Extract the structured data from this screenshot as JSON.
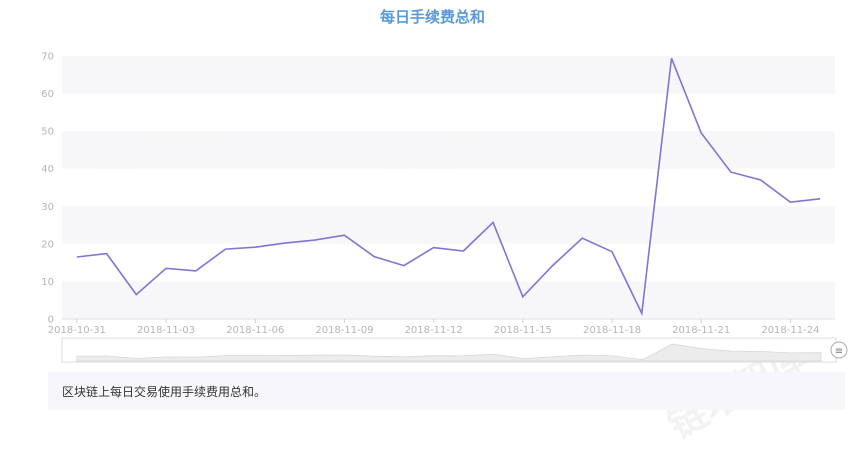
{
  "title": "每日手续费总和",
  "description": "区块链上每日交易使用手续费用总和。",
  "watermark": "链塔智库",
  "colors": {
    "line": "#8174d6",
    "title": "#5a9ad6",
    "band": "#f7f7f9",
    "axis_text": "#b5b5b5"
  },
  "chart_data": {
    "type": "line",
    "title": "每日手续费总和",
    "xlabel": "",
    "ylabel": "",
    "ylim": [
      0,
      70
    ],
    "y_ticks": [
      0,
      10,
      20,
      30,
      40,
      50,
      60,
      70
    ],
    "x_tick_labels": [
      "2018-10-31",
      "2018-11-03",
      "2018-11-06",
      "2018-11-09",
      "2018-11-12",
      "2018-11-15",
      "2018-11-18",
      "2018-11-21",
      "2018-11-24"
    ],
    "x": [
      "2018-10-31",
      "2018-11-01",
      "2018-11-02",
      "2018-11-03",
      "2018-11-04",
      "2018-11-05",
      "2018-11-06",
      "2018-11-07",
      "2018-11-08",
      "2018-11-09",
      "2018-11-10",
      "2018-11-11",
      "2018-11-12",
      "2018-11-13",
      "2018-11-14",
      "2018-11-15",
      "2018-11-16",
      "2018-11-17",
      "2018-11-18",
      "2018-11-19",
      "2018-11-20",
      "2018-11-21",
      "2018-11-22",
      "2018-11-23",
      "2018-11-24",
      "2018-11-25"
    ],
    "series": [
      {
        "values": [
          16.5,
          17.4,
          6.5,
          13.5,
          12.8,
          18.6,
          19.1,
          20.2,
          21.0,
          22.3,
          16.6,
          14.2,
          19.0,
          18.1,
          25.7,
          5.9,
          14.2,
          21.5,
          17.9,
          1.5,
          69.4,
          49.5,
          39.1,
          37.0,
          31.1,
          32.0
        ]
      }
    ],
    "grid": "horizontal bands",
    "legend": "none"
  },
  "slider": {
    "handle_icon": "≡"
  }
}
